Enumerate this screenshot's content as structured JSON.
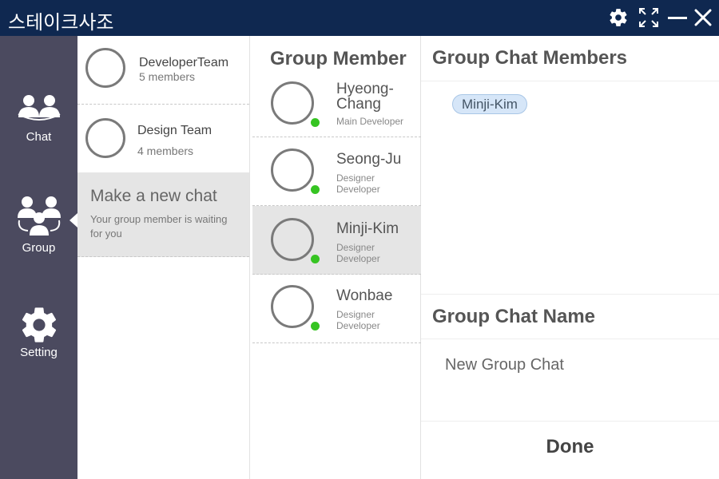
{
  "titlebar": {
    "title": "스테이크사조",
    "icons": [
      "gear-icon",
      "fullscreen-icon",
      "minimize-icon",
      "close-icon"
    ],
    "background": "#0f2850"
  },
  "nav": {
    "background": "#4b4a5f",
    "items": [
      {
        "label": "Chat",
        "icon": "chat-people-icon"
      },
      {
        "label": "Group",
        "icon": "group-people-icon"
      },
      {
        "label": "Setting",
        "icon": "gear-icon"
      }
    ]
  },
  "chat_list": {
    "items": [
      {
        "name": "DeveloperTeam",
        "count": "5 members"
      },
      {
        "name": "Design Team",
        "count": "4 members"
      }
    ],
    "make_new": {
      "title": "Make a new chat",
      "description": "Your group member is waiting for you"
    }
  },
  "group_member": {
    "title": "Group Member",
    "online_color": "#36c422",
    "members": [
      {
        "name": "Hyeong-Chang",
        "name_line1": "Hyeong-",
        "name_line2": "Chang",
        "role_line1": "Main Developer",
        "role_line2": "",
        "selected": false
      },
      {
        "name": "Seong-Ju",
        "name_line1": "Seong-Ju",
        "name_line2": "",
        "role_line1": "Designer",
        "role_line2": "Developer",
        "selected": false
      },
      {
        "name": "Minji-Kim",
        "name_line1": "Minji-Kim",
        "name_line2": "",
        "role_line1": "Designer",
        "role_line2": "Developer",
        "selected": true
      },
      {
        "name": "Wonbae",
        "name_line1": "Wonbae",
        "name_line2": "",
        "role_line1": "Designer",
        "role_line2": "Developer",
        "selected": false
      }
    ]
  },
  "group_chat": {
    "members_title": "Group Chat Members",
    "selected_members": [
      "Minji-Kim"
    ],
    "chip_color": "#d6e6f8",
    "name_title": "Group Chat Name",
    "name_value": "New Group Chat",
    "done_label": "Done"
  }
}
